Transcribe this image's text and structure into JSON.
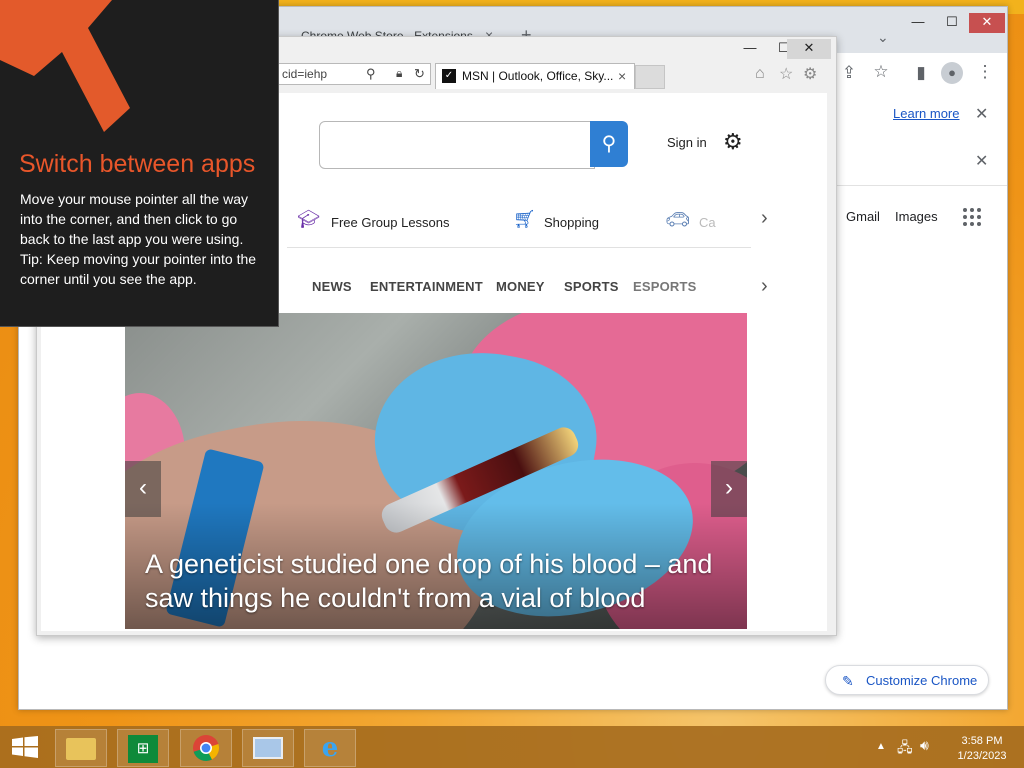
{
  "chrome": {
    "tab_title": "Chrome Web Store - Extensions",
    "tab_close": "×",
    "new_tab": "+",
    "tab_dropdown": "⌄",
    "minimize": "—",
    "maximize": "☐",
    "close": "✕",
    "toolbar_icons": [
      "share-icon",
      "star-icon",
      "side-panel-icon",
      "profile-icon",
      "menu-icon"
    ],
    "infobar_learn_more": "Learn more",
    "google_links": {
      "gmail": "Gmail",
      "images": "Images"
    },
    "customize_label": "Customize Chrome"
  },
  "ie": {
    "address_fragment": "cid=iehp",
    "tab_title": "MSN | Outlook, Office, Sky...",
    "tab_close": "×",
    "sign_in": "Sign in",
    "quick_links": [
      {
        "label": "Free Group Lessons",
        "icon": "graduation-cap-icon"
      },
      {
        "label": "Shopping",
        "icon": "cart-icon"
      },
      {
        "label": "Ca",
        "icon": "car-icon"
      }
    ],
    "nav_categories": [
      "NEWS",
      "ENTERTAINMENT",
      "MONEY",
      "SPORTS",
      "ESPORTS"
    ],
    "hero_headline": "A geneticist studied one drop of his blood – and saw things he couldn't from a vial of blood"
  },
  "charm_hint": {
    "title": "Switch between apps",
    "line1": "Move your mouse pointer all the way into the corner, and then click to go back to the last app you were using.",
    "line2": "Tip: Keep moving your pointer into the corner until you see the app."
  },
  "taskbar": {
    "apps": [
      "file-explorer-icon",
      "store-icon",
      "chrome-icon",
      "remote-desktop-icon",
      "ie-icon"
    ],
    "time": "3:58 PM",
    "date": "1/23/2023"
  },
  "colors": {
    "charm_accent": "#e8562a",
    "msn_search_button": "#2f7fd3",
    "chrome_link": "#1a56c5"
  }
}
